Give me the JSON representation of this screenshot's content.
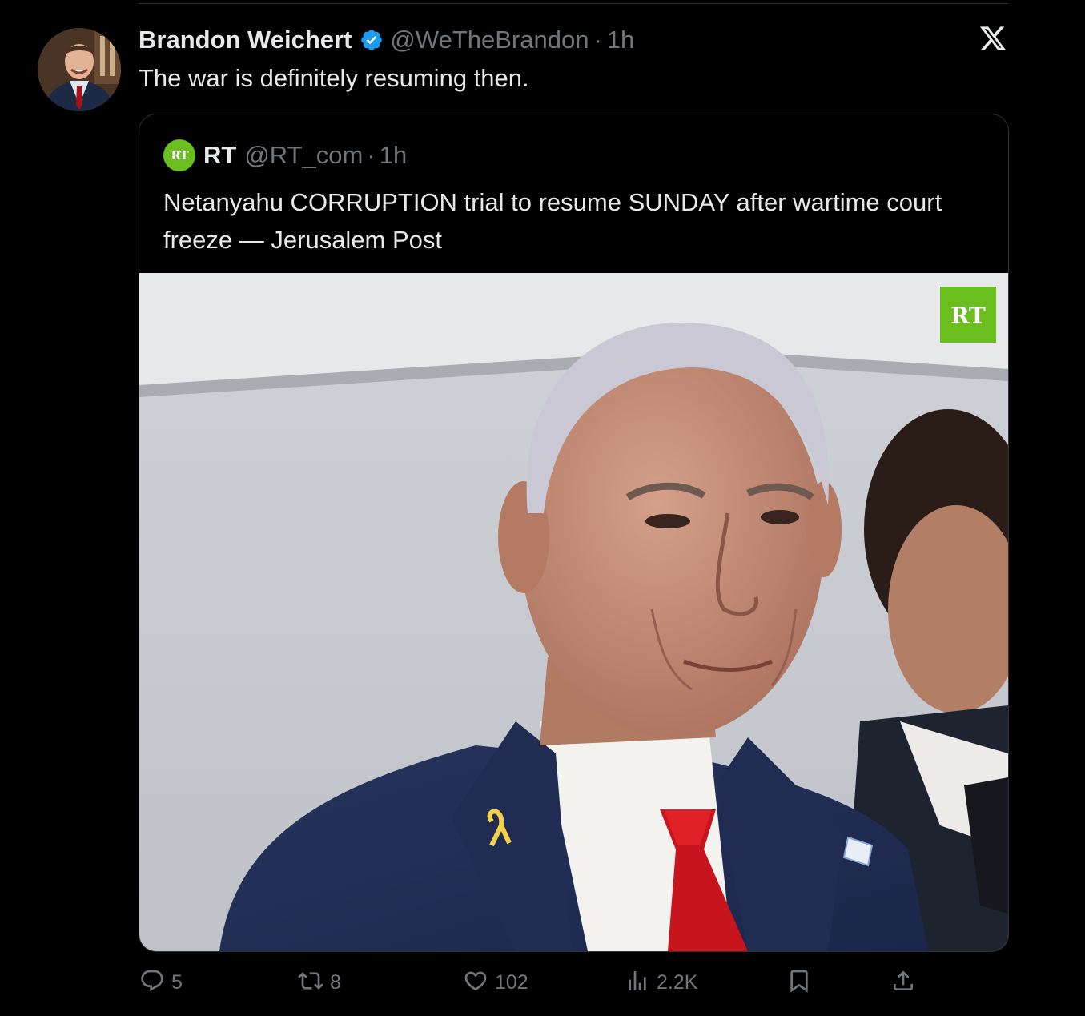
{
  "tweet": {
    "author_name": "Brandon Weichert",
    "handle": "@WeTheBrandon",
    "separator": "·",
    "time": "1h",
    "text": "The war is definitely resuming then.",
    "verified_icon": "verified-badge-icon",
    "platform_icon": "x-logo-icon"
  },
  "quote": {
    "author_name": "RT",
    "avatar_text": "RT",
    "handle": "@RT_com",
    "separator": "·",
    "time": "1h",
    "text": "Netanyahu CORRUPTION trial to resume SUNDAY after wartime court freeze — Jerusalem Post",
    "photo_watermark": "RT",
    "brand_color": "#6abf1e"
  },
  "actions": {
    "replies": "5",
    "reposts": "8",
    "likes": "102",
    "views": "2.2K"
  },
  "colors": {
    "background": "#000000",
    "text_primary": "#e7e9ea",
    "text_secondary": "#71767b",
    "border": "#2f3336",
    "verified": "#1d9bf0"
  }
}
